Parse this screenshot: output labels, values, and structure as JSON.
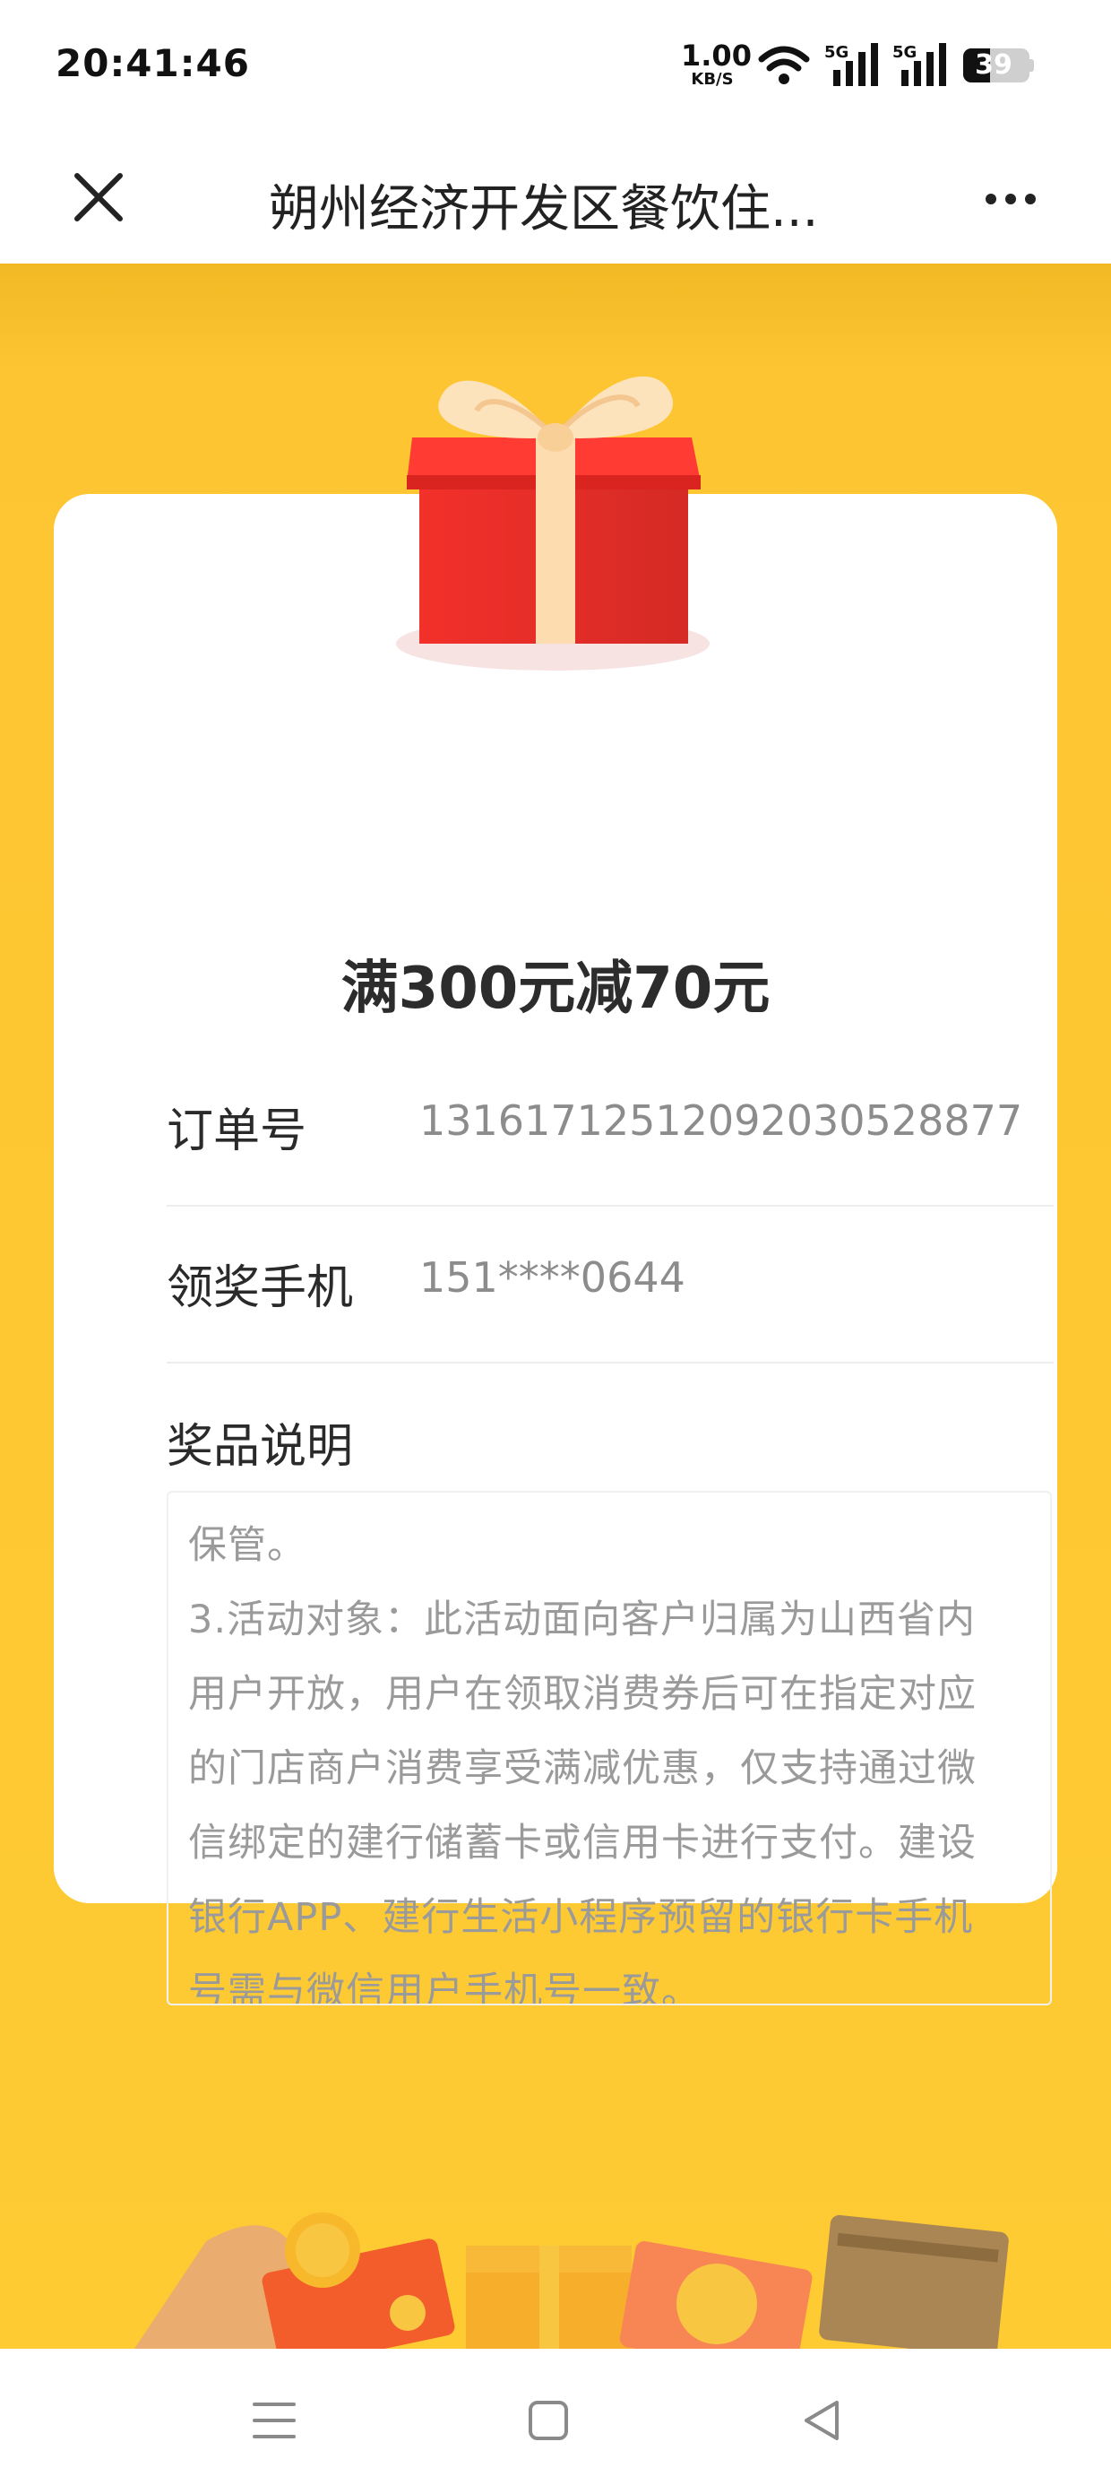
{
  "status_bar": {
    "time": "20:41:46",
    "net_speed_value": "1.00",
    "net_speed_unit": "KB/S",
    "signal1_tag": "5G",
    "signal2_tag": "5G",
    "battery_level": "39"
  },
  "nav": {
    "title": "朔州经济开发区餐饮住...",
    "close_icon": "close-icon",
    "more_icon": "more-icon"
  },
  "card": {
    "prize_title": "满300元减70元",
    "rows": [
      {
        "label": "订单号",
        "value": "1316171251209203052887​7"
      },
      {
        "label": "领奖手机",
        "value": "151****0644"
      }
    ],
    "description_label": "奖品说明",
    "description_lines": [
      "保管。",
      "3.活动对象：此活动面向客户归属为山西省内",
      "用户开放，用户在领取消费券后可在指定对应",
      "的门店商户消费享受满减优惠，仅支持通过微",
      "信绑定的建行储蓄卡或信用卡进行支付。建设",
      "银行APP、建行生活小程序预留的银行卡手机",
      "号需与微信用户手机号一致。"
    ]
  },
  "colors": {
    "background_yellow": "#fecb33",
    "gift_red": "#f3302a",
    "ribbon": "#fde0b0"
  }
}
